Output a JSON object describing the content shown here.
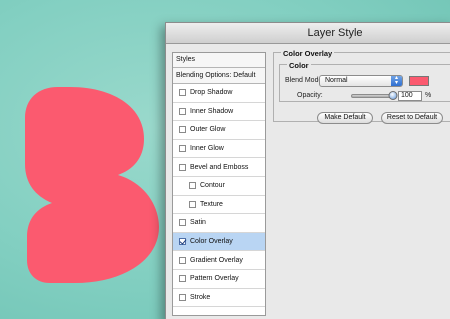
{
  "window": {
    "title": "Layer Style"
  },
  "styles_panel": {
    "header": "Styles",
    "blending_label": "Blending Options: Default",
    "items": [
      {
        "label": "Drop Shadow",
        "checked": false,
        "indent": false,
        "active": false
      },
      {
        "label": "Inner Shadow",
        "checked": false,
        "indent": false,
        "active": false
      },
      {
        "label": "Outer Glow",
        "checked": false,
        "indent": false,
        "active": false
      },
      {
        "label": "Inner Glow",
        "checked": false,
        "indent": false,
        "active": false
      },
      {
        "label": "Bevel and Emboss",
        "checked": false,
        "indent": false,
        "active": false
      },
      {
        "label": "Contour",
        "checked": false,
        "indent": true,
        "active": false
      },
      {
        "label": "Texture",
        "checked": false,
        "indent": true,
        "active": false
      },
      {
        "label": "Satin",
        "checked": false,
        "indent": false,
        "active": false
      },
      {
        "label": "Color Overlay",
        "checked": true,
        "indent": false,
        "active": true
      },
      {
        "label": "Gradient Overlay",
        "checked": false,
        "indent": false,
        "active": false
      },
      {
        "label": "Pattern Overlay",
        "checked": false,
        "indent": false,
        "active": false
      },
      {
        "label": "Stroke",
        "checked": false,
        "indent": false,
        "active": false
      }
    ]
  },
  "color_overlay": {
    "section_title": "Color Overlay",
    "group_title": "Color",
    "blend_mode_label": "Blend Mode:",
    "blend_mode_value": "Normal",
    "overlay_color": "#fb5a6f",
    "opacity_label": "Opacity:",
    "opacity_value": "100",
    "opacity_unit": "%",
    "opacity_fraction": 1.0,
    "make_default_label": "Make Default",
    "reset_default_label": "Reset to Default"
  },
  "canvas": {
    "background_color": "#7fcdbf",
    "shape_color": "#fb5a6f"
  }
}
